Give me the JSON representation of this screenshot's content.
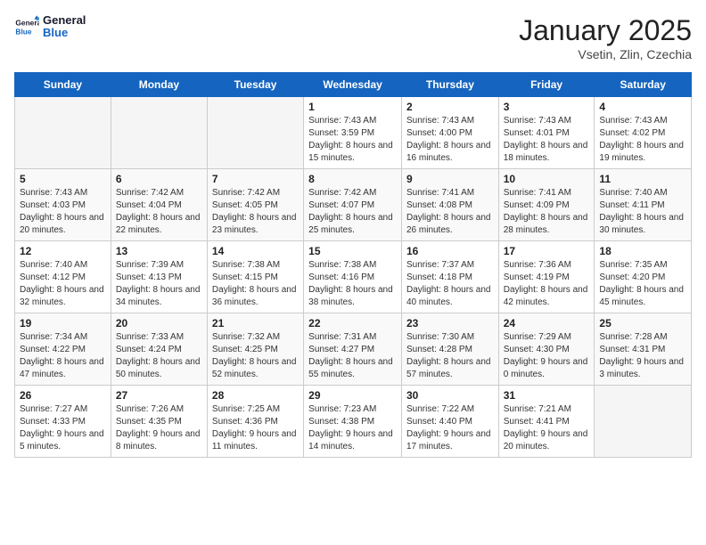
{
  "logo": {
    "text_general": "General",
    "text_blue": "Blue"
  },
  "header": {
    "title": "January 2025",
    "subtitle": "Vsetin, Zlin, Czechia"
  },
  "weekdays": [
    "Sunday",
    "Monday",
    "Tuesday",
    "Wednesday",
    "Thursday",
    "Friday",
    "Saturday"
  ],
  "weeks": [
    [
      {
        "day": "",
        "sunrise": "",
        "sunset": "",
        "daylight": ""
      },
      {
        "day": "",
        "sunrise": "",
        "sunset": "",
        "daylight": ""
      },
      {
        "day": "",
        "sunrise": "",
        "sunset": "",
        "daylight": ""
      },
      {
        "day": "1",
        "sunrise": "Sunrise: 7:43 AM",
        "sunset": "Sunset: 3:59 PM",
        "daylight": "Daylight: 8 hours and 15 minutes."
      },
      {
        "day": "2",
        "sunrise": "Sunrise: 7:43 AM",
        "sunset": "Sunset: 4:00 PM",
        "daylight": "Daylight: 8 hours and 16 minutes."
      },
      {
        "day": "3",
        "sunrise": "Sunrise: 7:43 AM",
        "sunset": "Sunset: 4:01 PM",
        "daylight": "Daylight: 8 hours and 18 minutes."
      },
      {
        "day": "4",
        "sunrise": "Sunrise: 7:43 AM",
        "sunset": "Sunset: 4:02 PM",
        "daylight": "Daylight: 8 hours and 19 minutes."
      }
    ],
    [
      {
        "day": "5",
        "sunrise": "Sunrise: 7:43 AM",
        "sunset": "Sunset: 4:03 PM",
        "daylight": "Daylight: 8 hours and 20 minutes."
      },
      {
        "day": "6",
        "sunrise": "Sunrise: 7:42 AM",
        "sunset": "Sunset: 4:04 PM",
        "daylight": "Daylight: 8 hours and 22 minutes."
      },
      {
        "day": "7",
        "sunrise": "Sunrise: 7:42 AM",
        "sunset": "Sunset: 4:05 PM",
        "daylight": "Daylight: 8 hours and 23 minutes."
      },
      {
        "day": "8",
        "sunrise": "Sunrise: 7:42 AM",
        "sunset": "Sunset: 4:07 PM",
        "daylight": "Daylight: 8 hours and 25 minutes."
      },
      {
        "day": "9",
        "sunrise": "Sunrise: 7:41 AM",
        "sunset": "Sunset: 4:08 PM",
        "daylight": "Daylight: 8 hours and 26 minutes."
      },
      {
        "day": "10",
        "sunrise": "Sunrise: 7:41 AM",
        "sunset": "Sunset: 4:09 PM",
        "daylight": "Daylight: 8 hours and 28 minutes."
      },
      {
        "day": "11",
        "sunrise": "Sunrise: 7:40 AM",
        "sunset": "Sunset: 4:11 PM",
        "daylight": "Daylight: 8 hours and 30 minutes."
      }
    ],
    [
      {
        "day": "12",
        "sunrise": "Sunrise: 7:40 AM",
        "sunset": "Sunset: 4:12 PM",
        "daylight": "Daylight: 8 hours and 32 minutes."
      },
      {
        "day": "13",
        "sunrise": "Sunrise: 7:39 AM",
        "sunset": "Sunset: 4:13 PM",
        "daylight": "Daylight: 8 hours and 34 minutes."
      },
      {
        "day": "14",
        "sunrise": "Sunrise: 7:38 AM",
        "sunset": "Sunset: 4:15 PM",
        "daylight": "Daylight: 8 hours and 36 minutes."
      },
      {
        "day": "15",
        "sunrise": "Sunrise: 7:38 AM",
        "sunset": "Sunset: 4:16 PM",
        "daylight": "Daylight: 8 hours and 38 minutes."
      },
      {
        "day": "16",
        "sunrise": "Sunrise: 7:37 AM",
        "sunset": "Sunset: 4:18 PM",
        "daylight": "Daylight: 8 hours and 40 minutes."
      },
      {
        "day": "17",
        "sunrise": "Sunrise: 7:36 AM",
        "sunset": "Sunset: 4:19 PM",
        "daylight": "Daylight: 8 hours and 42 minutes."
      },
      {
        "day": "18",
        "sunrise": "Sunrise: 7:35 AM",
        "sunset": "Sunset: 4:20 PM",
        "daylight": "Daylight: 8 hours and 45 minutes."
      }
    ],
    [
      {
        "day": "19",
        "sunrise": "Sunrise: 7:34 AM",
        "sunset": "Sunset: 4:22 PM",
        "daylight": "Daylight: 8 hours and 47 minutes."
      },
      {
        "day": "20",
        "sunrise": "Sunrise: 7:33 AM",
        "sunset": "Sunset: 4:24 PM",
        "daylight": "Daylight: 8 hours and 50 minutes."
      },
      {
        "day": "21",
        "sunrise": "Sunrise: 7:32 AM",
        "sunset": "Sunset: 4:25 PM",
        "daylight": "Daylight: 8 hours and 52 minutes."
      },
      {
        "day": "22",
        "sunrise": "Sunrise: 7:31 AM",
        "sunset": "Sunset: 4:27 PM",
        "daylight": "Daylight: 8 hours and 55 minutes."
      },
      {
        "day": "23",
        "sunrise": "Sunrise: 7:30 AM",
        "sunset": "Sunset: 4:28 PM",
        "daylight": "Daylight: 8 hours and 57 minutes."
      },
      {
        "day": "24",
        "sunrise": "Sunrise: 7:29 AM",
        "sunset": "Sunset: 4:30 PM",
        "daylight": "Daylight: 9 hours and 0 minutes."
      },
      {
        "day": "25",
        "sunrise": "Sunrise: 7:28 AM",
        "sunset": "Sunset: 4:31 PM",
        "daylight": "Daylight: 9 hours and 3 minutes."
      }
    ],
    [
      {
        "day": "26",
        "sunrise": "Sunrise: 7:27 AM",
        "sunset": "Sunset: 4:33 PM",
        "daylight": "Daylight: 9 hours and 5 minutes."
      },
      {
        "day": "27",
        "sunrise": "Sunrise: 7:26 AM",
        "sunset": "Sunset: 4:35 PM",
        "daylight": "Daylight: 9 hours and 8 minutes."
      },
      {
        "day": "28",
        "sunrise": "Sunrise: 7:25 AM",
        "sunset": "Sunset: 4:36 PM",
        "daylight": "Daylight: 9 hours and 11 minutes."
      },
      {
        "day": "29",
        "sunrise": "Sunrise: 7:23 AM",
        "sunset": "Sunset: 4:38 PM",
        "daylight": "Daylight: 9 hours and 14 minutes."
      },
      {
        "day": "30",
        "sunrise": "Sunrise: 7:22 AM",
        "sunset": "Sunset: 4:40 PM",
        "daylight": "Daylight: 9 hours and 17 minutes."
      },
      {
        "day": "31",
        "sunrise": "Sunrise: 7:21 AM",
        "sunset": "Sunset: 4:41 PM",
        "daylight": "Daylight: 9 hours and 20 minutes."
      },
      {
        "day": "",
        "sunrise": "",
        "sunset": "",
        "daylight": ""
      }
    ]
  ]
}
